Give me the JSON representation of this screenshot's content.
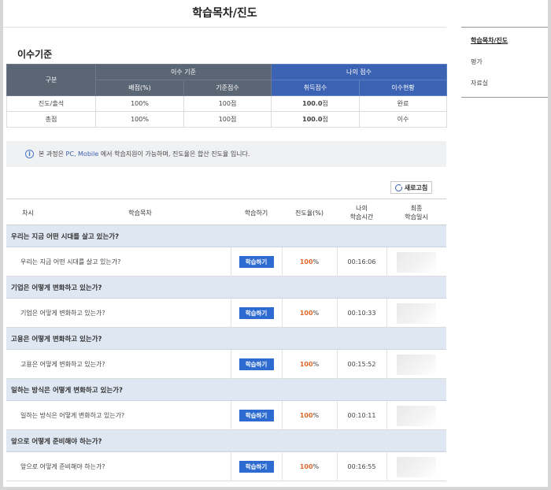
{
  "page_title": "학습목차/진도",
  "section_title": "이수기준",
  "criteria": {
    "headers": {
      "category": "구분",
      "completion_criteria": "이수 기준",
      "my_score": "나의 점수",
      "weight": "배점(%)",
      "base_score": "기준점수",
      "acquired_score": "취득점수",
      "completion_status": "이수현황"
    },
    "rows": [
      {
        "category": "진도/출석",
        "weight": "100%",
        "base_score": "100점",
        "acquired_value": "100.0",
        "acquired_unit": "점",
        "status": "완료"
      },
      {
        "category": "총점",
        "weight": "100%",
        "base_score": "100점",
        "acquired_value": "100.0",
        "acquired_unit": "점",
        "status": "이수"
      }
    ]
  },
  "notice": {
    "prefix": "본 과정은 ",
    "devices": "PC, Mobile",
    "suffix": " 에서 학습지원이 가능하며, 진도율은 합산 진도율 입니다."
  },
  "refresh_label": "새로고침",
  "list_headers": {
    "session": "차시",
    "contents": "학습목차",
    "study": "학습하기",
    "progress": "진도율(%)",
    "my_time_1": "나의",
    "my_time_2": "학습시간",
    "last_1": "최종",
    "last_2": "학습일시"
  },
  "study_button_label": "학습하기",
  "groups": [
    {
      "title": "우리는 지금 어떤 시대를 살고 있는가?",
      "item": "우리는 지금 어떤 시대를 살고 있는가?",
      "progress": "100",
      "time": "00:16:06"
    },
    {
      "title": "기업은 어떻게 변화하고 있는가?",
      "item": "기업은 어떻게 변화하고 있는가?",
      "progress": "100",
      "time": "00:10:33"
    },
    {
      "title": "고용은 어떻게 변화하고 있는가?",
      "item": "고용은 어떻게 변화하고 있는가?",
      "progress": "100",
      "time": "00:15:52"
    },
    {
      "title": "일하는 방식은 어떻게 변화하고 있는가?",
      "item": "일하는 방식은 어떻게 변화하고 있는가?",
      "progress": "100",
      "time": "00:10:11"
    },
    {
      "title": "앞으로 어떻게 준비해야 하는가?",
      "item": "앞으로 어떻게 준비해야 하는가?",
      "progress": "100",
      "time": "00:16:55"
    }
  ],
  "side_menu": [
    "학습목차/진도",
    "평가",
    "자료실"
  ],
  "colors": {
    "header_dark": "#5b6675",
    "header_blue": "#3b62b3",
    "accent_orange": "#e0682a",
    "button_blue": "#2d6bd1",
    "group_bg": "#dfe7f3"
  }
}
